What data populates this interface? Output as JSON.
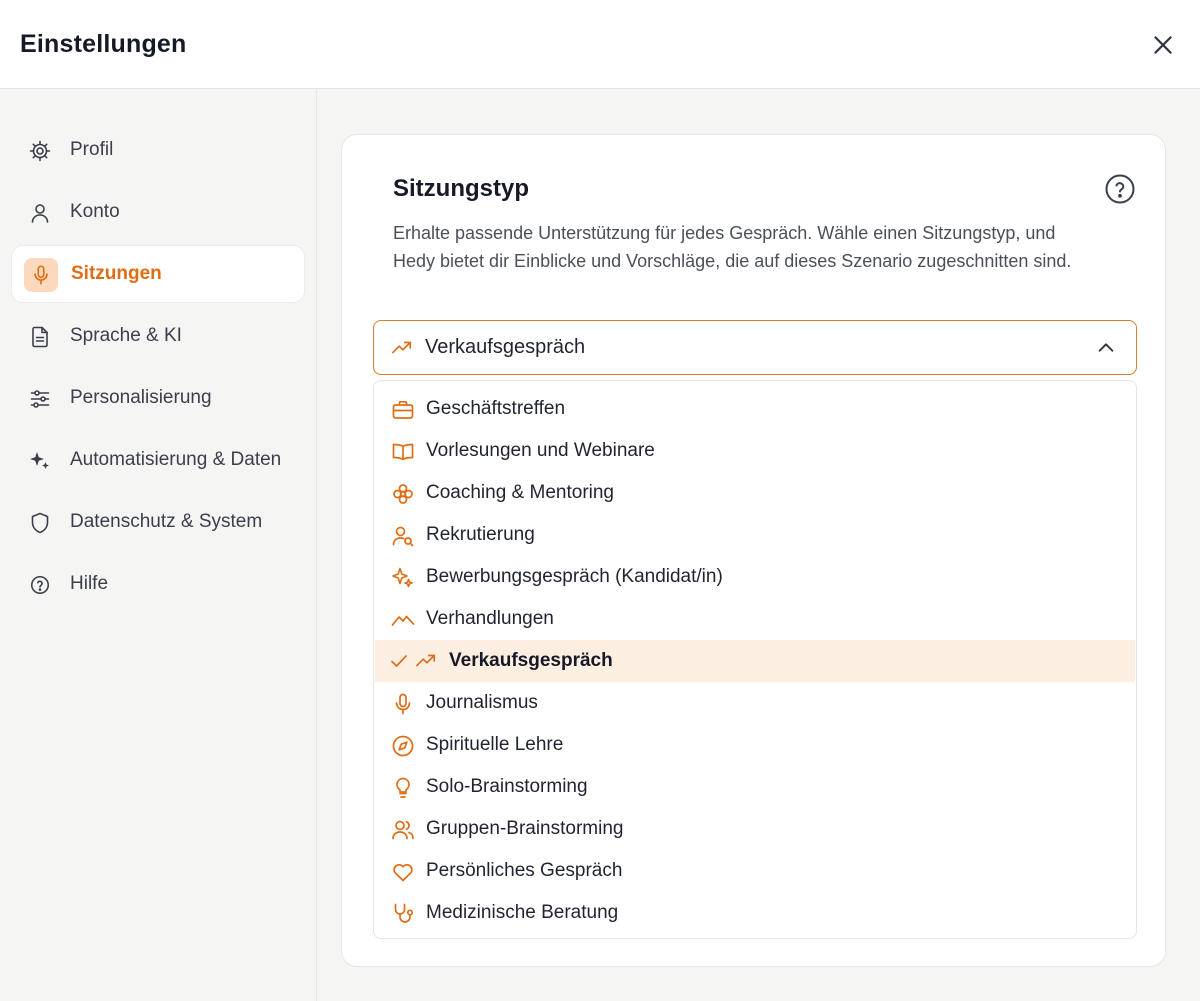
{
  "header": {
    "title": "Einstellungen"
  },
  "colors": {
    "accent": "#e06c14",
    "accent_soft": "#fcd9bd",
    "selected_row": "#fdeee2"
  },
  "sidebar": {
    "items": [
      {
        "label": "Profil",
        "icon": "gear-icon",
        "active": false
      },
      {
        "label": "Konto",
        "icon": "user-icon",
        "active": false
      },
      {
        "label": "Sitzungen",
        "icon": "microphone-icon",
        "active": true
      },
      {
        "label": "Sprache & KI",
        "icon": "document-icon",
        "active": false
      },
      {
        "label": "Personalisierung",
        "icon": "sliders-icon",
        "active": false
      },
      {
        "label": "Automatisierung & Daten",
        "icon": "sparkles-icon",
        "active": false
      },
      {
        "label": "Datenschutz & System",
        "icon": "shield-icon",
        "active": false
      },
      {
        "label": "Hilfe",
        "icon": "help-circle-icon",
        "active": false
      }
    ]
  },
  "main": {
    "title": "Sitzungstyp",
    "description": "Erhalte passende Unterstützung für jedes Gespräch. Wähle einen Sitzungstyp, und Hedy bietet dir Einblicke und Vorschläge, die auf dieses Szenario zugeschnitten sind.",
    "select": {
      "value": "Verkaufsgespräch",
      "icon": "trending-up-icon",
      "expanded": true
    },
    "options": [
      {
        "label": "Geschäftstreffen",
        "icon": "briefcase-icon",
        "selected": false
      },
      {
        "label": "Vorlesungen und Webinare",
        "icon": "book-open-icon",
        "selected": false
      },
      {
        "label": "Coaching & Mentoring",
        "icon": "flower-icon",
        "selected": false
      },
      {
        "label": "Rekrutierung",
        "icon": "user-search-icon",
        "selected": false
      },
      {
        "label": "Bewerbungsgespräch (Kandidat/in)",
        "icon": "sparkles-icon",
        "selected": false
      },
      {
        "label": "Verhandlungen",
        "icon": "mountain-icon",
        "selected": false
      },
      {
        "label": "Verkaufsgespräch",
        "icon": "trending-up-icon",
        "selected": true
      },
      {
        "label": "Journalismus",
        "icon": "microphone-icon",
        "selected": false
      },
      {
        "label": "Spirituelle Lehre",
        "icon": "compass-icon",
        "selected": false
      },
      {
        "label": "Solo-Brainstorming",
        "icon": "lightbulb-icon",
        "selected": false
      },
      {
        "label": "Gruppen-Brainstorming",
        "icon": "users-icon",
        "selected": false
      },
      {
        "label": "Persönliches Gespräch",
        "icon": "heart-icon",
        "selected": false
      },
      {
        "label": "Medizinische Beratung",
        "icon": "stethoscope-icon",
        "selected": false
      }
    ]
  }
}
